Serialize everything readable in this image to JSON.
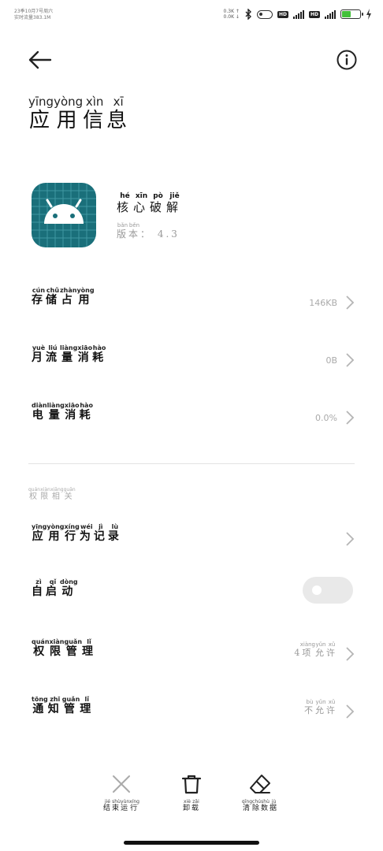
{
  "status": {
    "line1": "23季10月7号周六",
    "line2": "实时流量383.1M",
    "speed_up": "0.3K ↑",
    "speed_down": "0.0K ↓",
    "battery_percent": 50
  },
  "header": {
    "title_chars": [
      {
        "c": "应",
        "p": "yīng"
      },
      {
        "c": "用",
        "p": "yòng"
      },
      {
        "c": "信",
        "p": "xìn"
      },
      {
        "c": "息",
        "p": "xī"
      }
    ]
  },
  "app": {
    "name_chars": [
      {
        "c": "核",
        "p": "hé"
      },
      {
        "c": "心",
        "p": "xīn"
      },
      {
        "c": "破",
        "p": "pò"
      },
      {
        "c": "解",
        "p": "jiě"
      }
    ],
    "version_chars": [
      {
        "c": "版",
        "p": "bǎn"
      },
      {
        "c": "本",
        "p": "běn"
      }
    ],
    "version_value": "： 4.3",
    "icon_color": "#1a6f7a"
  },
  "rows": {
    "storage": {
      "chars": [
        {
          "c": "存",
          "p": "cún"
        },
        {
          "c": "储",
          "p": "chǔ"
        },
        {
          "c": "占",
          "p": "zhàn"
        },
        {
          "c": "用",
          "p": "yòng"
        }
      ],
      "value": "146KB"
    },
    "data": {
      "chars": [
        {
          "c": "月",
          "p": "yuè"
        },
        {
          "c": "流",
          "p": "liú"
        },
        {
          "c": "量",
          "p": "liàng"
        },
        {
          "c": "消",
          "p": "xiāo"
        },
        {
          "c": "耗",
          "p": "hào"
        }
      ],
      "value": "0B"
    },
    "battery": {
      "chars": [
        {
          "c": "电",
          "p": "diàn"
        },
        {
          "c": "量",
          "p": "liàng"
        },
        {
          "c": "消",
          "p": "xiāo"
        },
        {
          "c": "耗",
          "p": "hào"
        }
      ],
      "value": "0.0%"
    }
  },
  "permissions_section": {
    "chars": [
      {
        "c": "权",
        "p": "quán"
      },
      {
        "c": "限",
        "p": "xiàn"
      },
      {
        "c": "相",
        "p": "xiāng"
      },
      {
        "c": "关",
        "p": "guān"
      }
    ]
  },
  "rows2": {
    "behavior": {
      "chars": [
        {
          "c": "应",
          "p": "yīng"
        },
        {
          "c": "用",
          "p": "yòng"
        },
        {
          "c": "行",
          "p": "xíng"
        },
        {
          "c": "为",
          "p": "wéi"
        },
        {
          "c": "记",
          "p": "jì"
        },
        {
          "c": "录",
          "p": "lù"
        }
      ]
    },
    "autostart": {
      "chars": [
        {
          "c": "自",
          "p": "zì"
        },
        {
          "c": "启",
          "p": "qǐ"
        },
        {
          "c": "动",
          "p": "dòng"
        }
      ],
      "enabled": false
    },
    "perm_manage": {
      "chars": [
        {
          "c": "权",
          "p": "quán"
        },
        {
          "c": "限",
          "p": "xiàn"
        },
        {
          "c": "管",
          "p": "guǎn"
        },
        {
          "c": "理",
          "p": "lǐ"
        }
      ],
      "value_prefix": "4",
      "value_chars": [
        {
          "c": "项",
          "p": "xiàng"
        },
        {
          "c": "允",
          "p": "yǔn"
        },
        {
          "c": "许",
          "p": "xǔ"
        }
      ]
    },
    "notif_manage": {
      "chars": [
        {
          "c": "通",
          "p": "tōng"
        },
        {
          "c": "知",
          "p": "zhī"
        },
        {
          "c": "管",
          "p": "guǎn"
        },
        {
          "c": "理",
          "p": "lǐ"
        }
      ],
      "value_chars": [
        {
          "c": "不",
          "p": "bù"
        },
        {
          "c": "允",
          "p": "yǔn"
        },
        {
          "c": "许",
          "p": "xǔ"
        }
      ]
    }
  },
  "actions": {
    "force_stop": {
      "chars": [
        {
          "c": "结",
          "p": "jié"
        },
        {
          "c": "束",
          "p": "shù"
        },
        {
          "c": "运",
          "p": "yùn"
        },
        {
          "c": "行",
          "p": "xíng"
        }
      ]
    },
    "uninstall": {
      "chars": [
        {
          "c": "卸",
          "p": "xiè"
        },
        {
          "c": "载",
          "p": "zǎi"
        }
      ]
    },
    "clear_data": {
      "chars": [
        {
          "c": "清",
          "p": "qīng"
        },
        {
          "c": "除",
          "p": "chú"
        },
        {
          "c": "数",
          "p": "shù"
        },
        {
          "c": "据",
          "p": "jù"
        }
      ]
    }
  }
}
